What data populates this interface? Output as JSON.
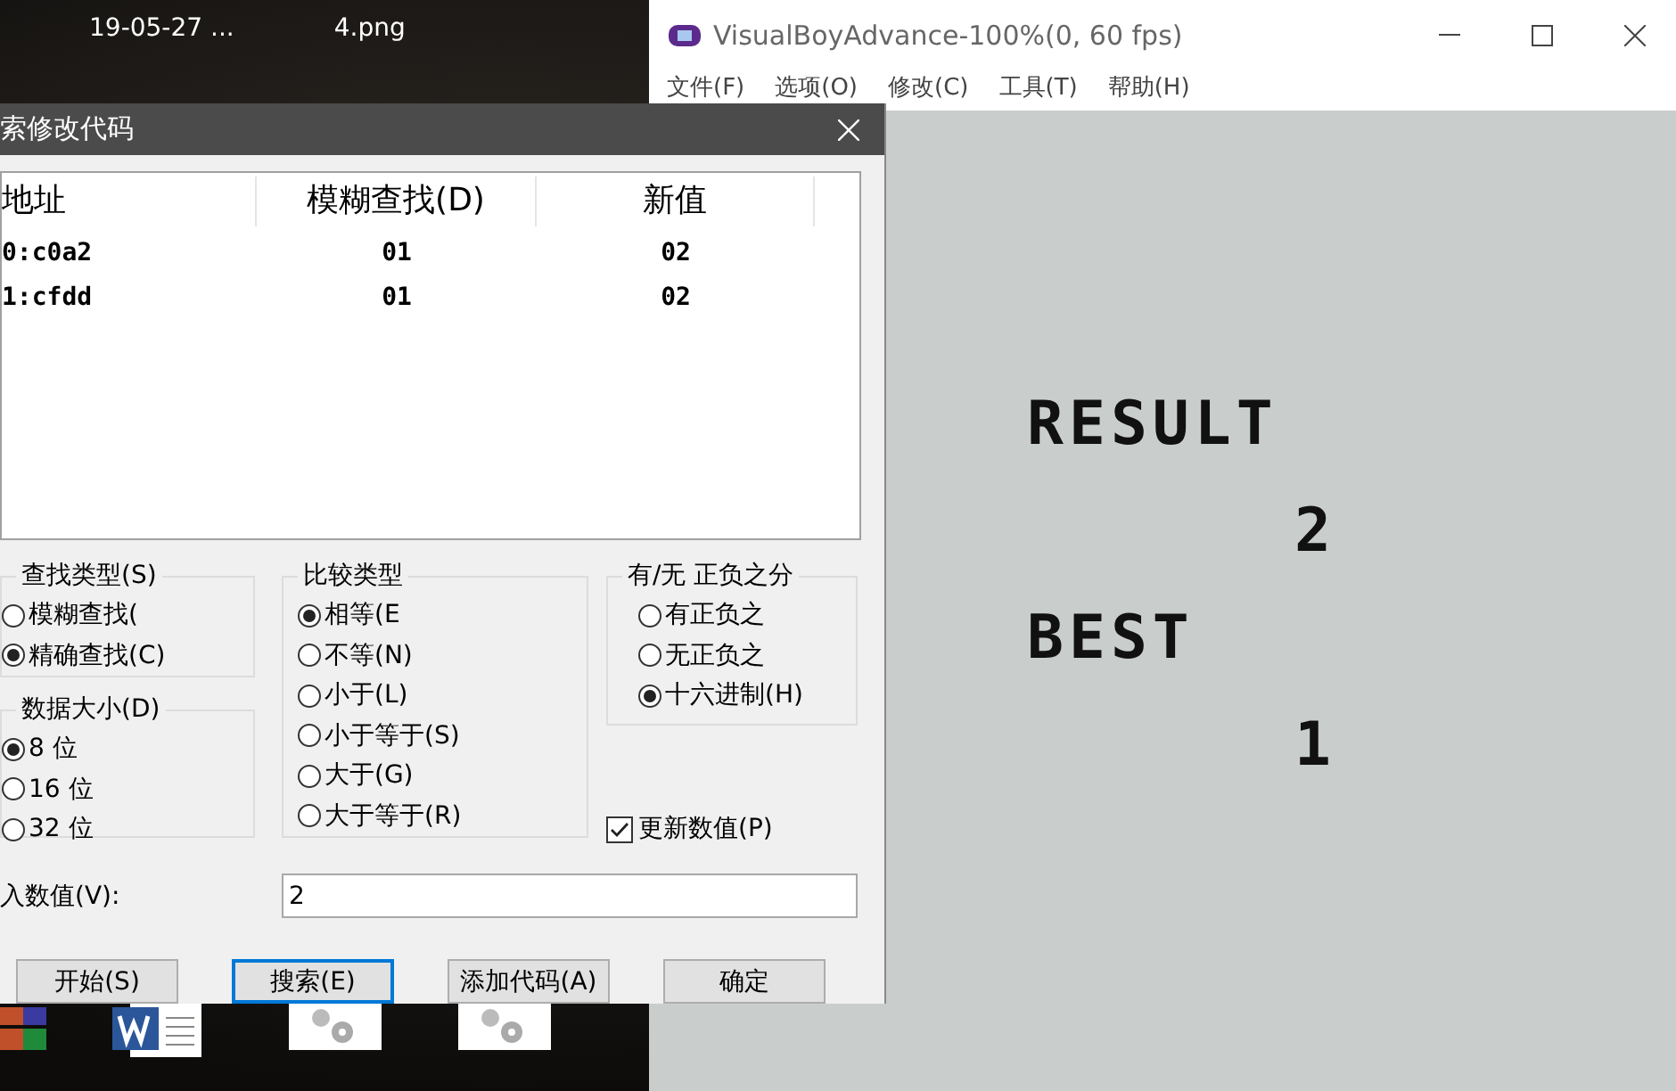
{
  "desktop": {
    "icon_labels": [
      {
        "label": "19-05-27 ..."
      },
      {
        "label": "4.png"
      }
    ]
  },
  "emulator": {
    "title": "VisualBoyAdvance-100%(0, 60 fps)",
    "menu": [
      "文件(F)",
      "选项(O)",
      "修改(C)",
      "工具(T)",
      "帮助(H)"
    ],
    "screen_lines": [
      {
        "text": "RESULT",
        "kind": "label"
      },
      {
        "text": "2",
        "kind": "value"
      },
      {
        "text": "BEST",
        "kind": "label"
      },
      {
        "text": "1",
        "kind": "value"
      }
    ]
  },
  "dialog": {
    "title": "索修改代码",
    "table": {
      "columns": [
        "地址",
        "模糊查找(D)",
        "新值"
      ],
      "rows": [
        [
          "0:c0a2",
          "01",
          "02"
        ],
        [
          "1:cfdd",
          "01",
          "02"
        ]
      ]
    },
    "search_type": {
      "label": "查找类型(S)",
      "options": [
        {
          "label": "模糊查找(",
          "selected": false
        },
        {
          "label": "精确查找(C)",
          "selected": true
        }
      ]
    },
    "data_size": {
      "label": "数据大小(D)",
      "options": [
        {
          "label": "8 位",
          "selected": true
        },
        {
          "label": "16 位",
          "selected": false
        },
        {
          "label": "32 位",
          "selected": false
        }
      ]
    },
    "compare_type": {
      "label": "比较类型",
      "options": [
        {
          "label": "相等(E",
          "selected": true
        },
        {
          "label": "不等(N)",
          "selected": false
        },
        {
          "label": "小于(L)",
          "selected": false
        },
        {
          "label": "小于等于(S)",
          "selected": false
        },
        {
          "label": "大于(G)",
          "selected": false
        },
        {
          "label": "大于等于(R)",
          "selected": false
        }
      ]
    },
    "sign": {
      "label": "有/无 正负之分",
      "options": [
        {
          "label": "有正负之",
          "selected": false
        },
        {
          "label": "无正负之",
          "selected": false
        },
        {
          "label": "十六进制(H)",
          "selected": true
        }
      ]
    },
    "update_values": {
      "label": "更新数值(P)",
      "checked": true
    },
    "input": {
      "label": "入数值(V):",
      "value": "2"
    },
    "buttons": [
      {
        "label": "开始(S)",
        "focused": false
      },
      {
        "label": "搜索(E)",
        "focused": true
      },
      {
        "label": "添加代码(A)",
        "focused": false
      },
      {
        "label": "确定",
        "focused": false
      }
    ]
  }
}
